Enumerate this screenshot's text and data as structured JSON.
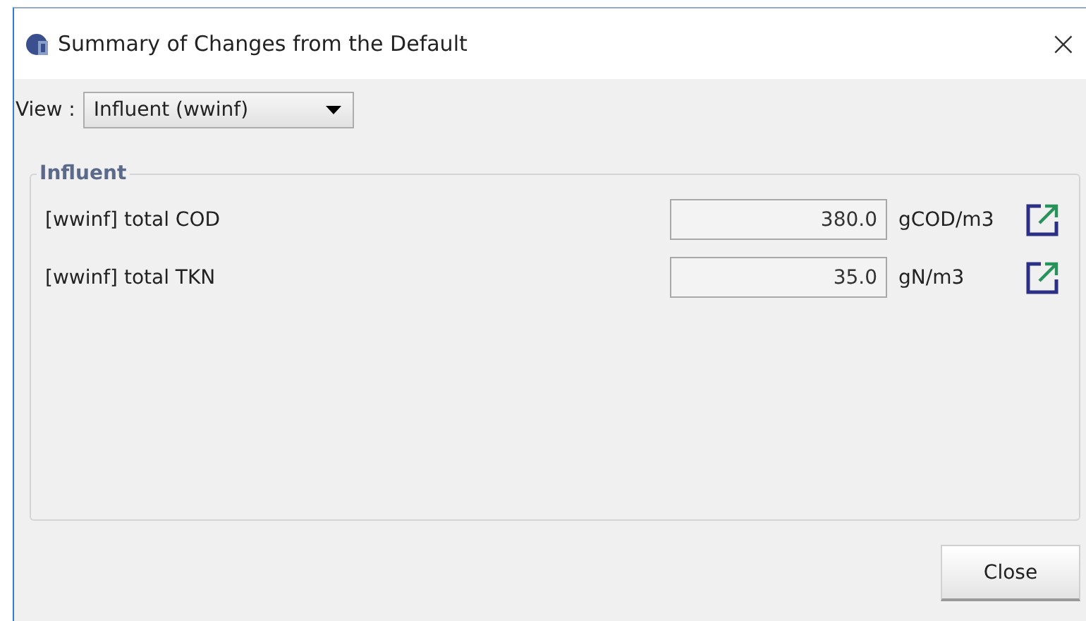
{
  "window": {
    "title": "Summary of Changes from the Default",
    "close": "×"
  },
  "view": {
    "label": "View :",
    "value": "Influent (wwinf)"
  },
  "group": {
    "title": "Influent",
    "rows": [
      {
        "label": "[wwinf] total COD",
        "value": "380.0",
        "unit": "gCOD/m3"
      },
      {
        "label": "[wwinf] total TKN",
        "value": "35.0",
        "unit": "gN/m3"
      }
    ]
  },
  "buttons": [
    "Close"
  ]
}
